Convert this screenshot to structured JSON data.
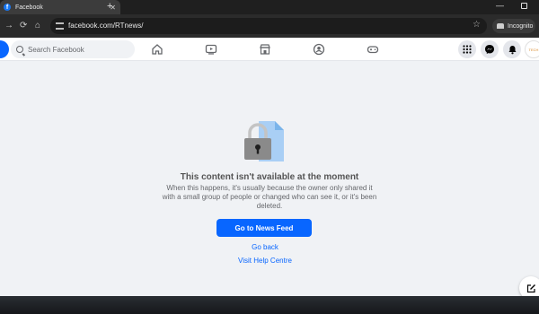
{
  "browser": {
    "tab_title": "Facebook",
    "tab_favicon": "f",
    "new_tab_icon": "+",
    "url": "facebook.com/RTnews/",
    "incognito_label": "Incognito"
  },
  "facebook": {
    "search_placeholder": "Search Facebook",
    "avatar_text": "TECH"
  },
  "content": {
    "title": "This content isn't available at the moment",
    "body": "When this happens, it's usually because the owner only shared it with a small group of people or changed who can see it, or it's been deleted.",
    "primary_button": "Go to News Feed",
    "link_back": "Go back",
    "link_help": "Visit Help Centre"
  },
  "colors": {
    "brand_blue": "#0866ff",
    "page_bg": "#f0f2f5",
    "chrome_dark": "#2b2b2b"
  }
}
